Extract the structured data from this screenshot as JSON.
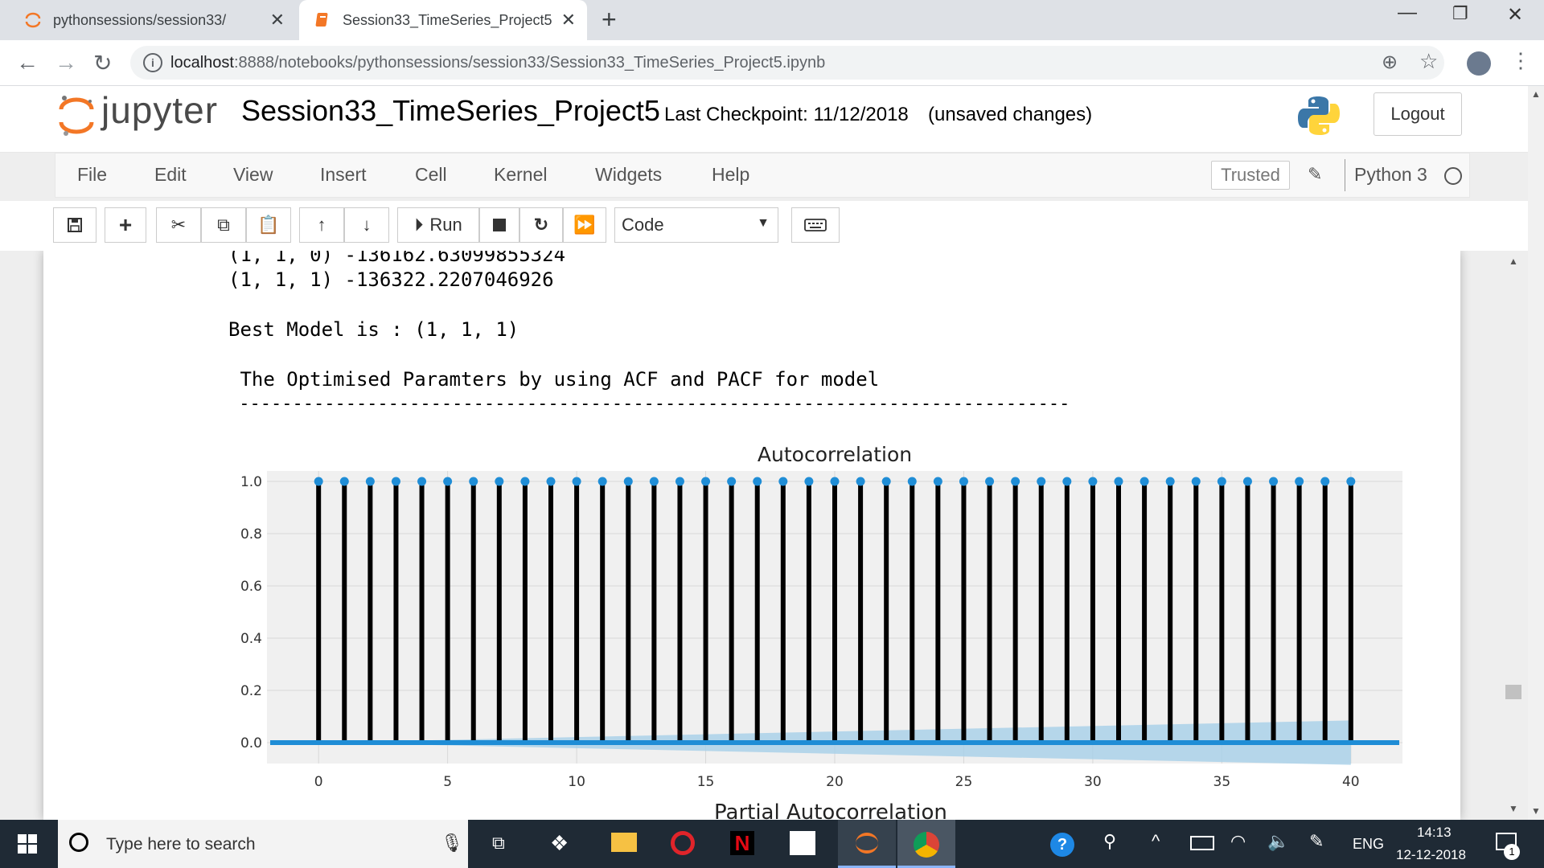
{
  "browser": {
    "tabs": [
      {
        "label": "pythonsessions/session33/"
      },
      {
        "label": "Session33_TimeSeries_Project5"
      }
    ],
    "url_host": "localhost",
    "url_rest": ":8888/notebooks/pythonsessions/session33/Session33_TimeSeries_Project5.ipynb"
  },
  "jupyter": {
    "logo_text": "jupyter",
    "notebook_title": "Session33_TimeSeries_Project5",
    "checkpoint": "Last Checkpoint: 11/12/2018",
    "unsaved": "(unsaved changes)",
    "logout_label": "Logout",
    "menu": [
      "File",
      "Edit",
      "View",
      "Insert",
      "Cell",
      "Kernel",
      "Widgets",
      "Help"
    ],
    "trusted_label": "Trusted",
    "kernel_name": "Python 3",
    "toolbar": {
      "run_label": "Run",
      "cell_type": "Code"
    }
  },
  "output": {
    "line1": "(1, 1, 0) -136162.63099855324",
    "line2": "(1, 1, 1) -136322.2207046926",
    "best_model": "Best Model is : (1, 1, 1)",
    "opt_params": " The Optimised Paramters by using ACF and PACF for model",
    "dashes": " ------------------------------------------------------------------------------",
    "next_chart_title": "Partial Autocorrelation"
  },
  "chart_data": {
    "type": "stem",
    "title": "Autocorrelation",
    "xlabel": "",
    "ylabel": "",
    "x_ticks": [
      0,
      5,
      10,
      15,
      20,
      25,
      30,
      35,
      40
    ],
    "x_tick_labels": [
      "0",
      "5",
      "10",
      "15",
      "20",
      "25",
      "30",
      "35",
      "40"
    ],
    "y_ticks": [
      0.0,
      0.2,
      0.4,
      0.6,
      0.8,
      1.0
    ],
    "y_tick_labels": [
      "0.0",
      "0.2",
      "0.4",
      "0.6",
      "0.8",
      "1.0"
    ],
    "xlim": [
      -2,
      42
    ],
    "ylim": [
      -0.08,
      1.04
    ],
    "lags": [
      0,
      1,
      2,
      3,
      4,
      5,
      6,
      7,
      8,
      9,
      10,
      11,
      12,
      13,
      14,
      15,
      16,
      17,
      18,
      19,
      20,
      21,
      22,
      23,
      24,
      25,
      26,
      27,
      28,
      29,
      30,
      31,
      32,
      33,
      34,
      35,
      36,
      37,
      38,
      39,
      40
    ],
    "values": [
      1.0,
      1.0,
      1.0,
      1.0,
      1.0,
      1.0,
      1.0,
      1.0,
      1.0,
      1.0,
      1.0,
      1.0,
      1.0,
      1.0,
      1.0,
      1.0,
      1.0,
      1.0,
      1.0,
      1.0,
      1.0,
      1.0,
      1.0,
      1.0,
      1.0,
      1.0,
      1.0,
      1.0,
      1.0,
      1.0,
      1.0,
      1.0,
      1.0,
      1.0,
      1.0,
      1.0,
      1.0,
      1.0,
      1.0,
      1.0,
      1.0
    ],
    "confidence_band_end": 0.085,
    "grid": true,
    "colors": {
      "stem": "#000000",
      "marker": "#1f8dd6",
      "band": "#a6cfe8",
      "background": "#f0f0f0"
    }
  },
  "taskbar": {
    "search_placeholder": "Type here to search",
    "language": "ENG",
    "time": "14:13",
    "date": "12-12-2018",
    "notification_count": "1"
  }
}
